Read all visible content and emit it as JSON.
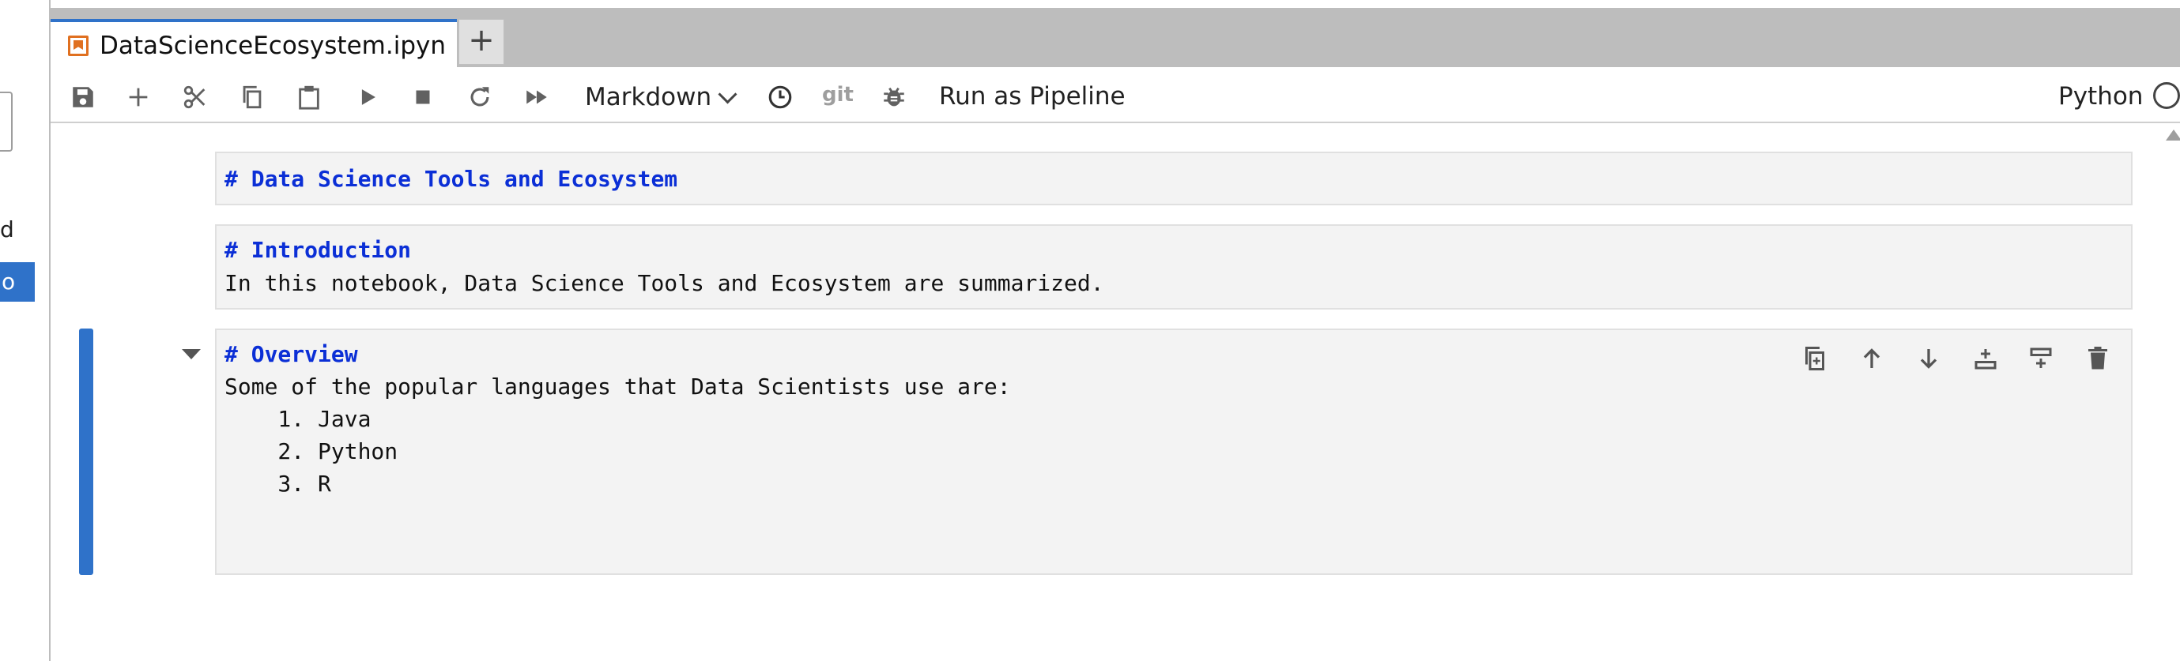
{
  "sidebar": {
    "partial_text": "d",
    "selected_partial_text": "o"
  },
  "tabs": [
    {
      "label": "DataScienceEcosystem.ipyn",
      "dirty": true
    }
  ],
  "new_tab_label": "+",
  "toolbar": {
    "buttons": [
      "save-icon",
      "add-icon",
      "cut-icon",
      "copy-icon",
      "paste-icon",
      "run-icon",
      "stop-icon",
      "restart-icon",
      "run-all-icon",
      "clock-icon",
      "bug-icon"
    ],
    "cell_type": "Markdown",
    "git_label": "git",
    "run_pipeline_label": "Run as Pipeline",
    "kernel_name": "Python"
  },
  "cells": [
    {
      "lines": [
        {
          "text": "# Data Science Tools and Ecosystem",
          "heading": true
        }
      ]
    },
    {
      "lines": [
        {
          "text": "# Introduction",
          "heading": true
        },
        {
          "text": "In this notebook, Data Science Tools and Ecosystem are summarized.",
          "heading": false
        }
      ]
    },
    {
      "lines": [
        {
          "text": "# Overview",
          "heading": true
        },
        {
          "text": "Some of the popular languages that Data Scientists use are:",
          "heading": false
        },
        {
          "text": "    1. Java",
          "heading": false
        },
        {
          "text": "    2. Python",
          "heading": false
        },
        {
          "text": "    3. R",
          "heading": false
        }
      ]
    }
  ],
  "cell_toolbar": [
    "duplicate-cell-icon",
    "move-up-icon",
    "move-down-icon",
    "insert-below-icon",
    "insert-above-icon",
    "delete-icon"
  ],
  "colors": {
    "accent": "#2f72c9",
    "heading": "#0b2fd6",
    "tab_icon": "#e07020"
  }
}
